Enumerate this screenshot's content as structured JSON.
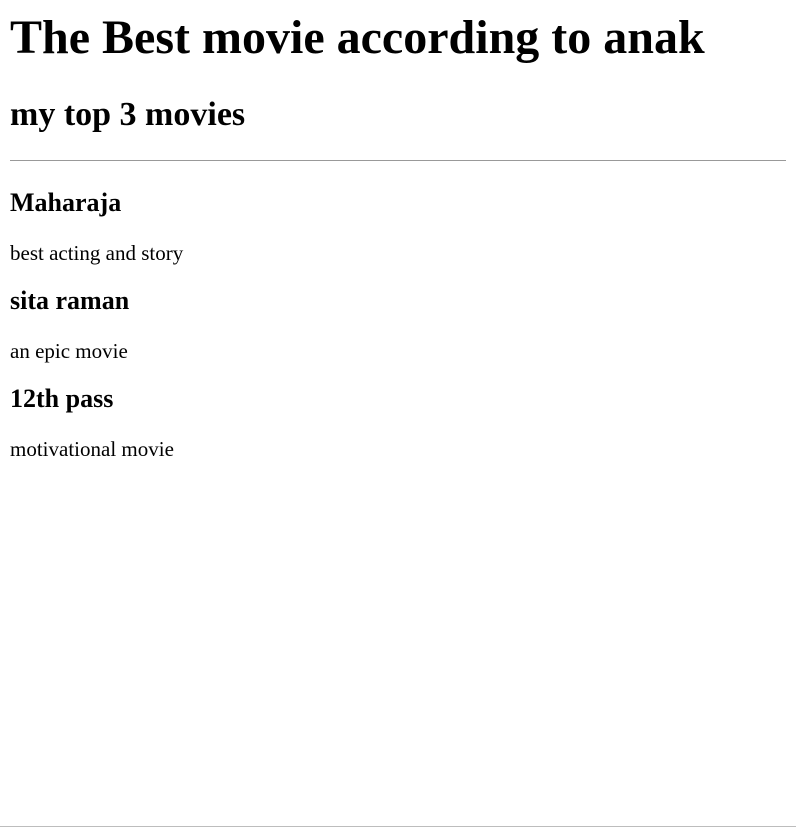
{
  "header": {
    "title": "The Best movie according to anak",
    "subtitle": "my top 3 movies"
  },
  "movies": [
    {
      "title": "Maharaja",
      "description": "best acting and story"
    },
    {
      "title": "sita raman",
      "description": "an epic movie"
    },
    {
      "title": "12th pass",
      "description": "motivational movie"
    }
  ]
}
